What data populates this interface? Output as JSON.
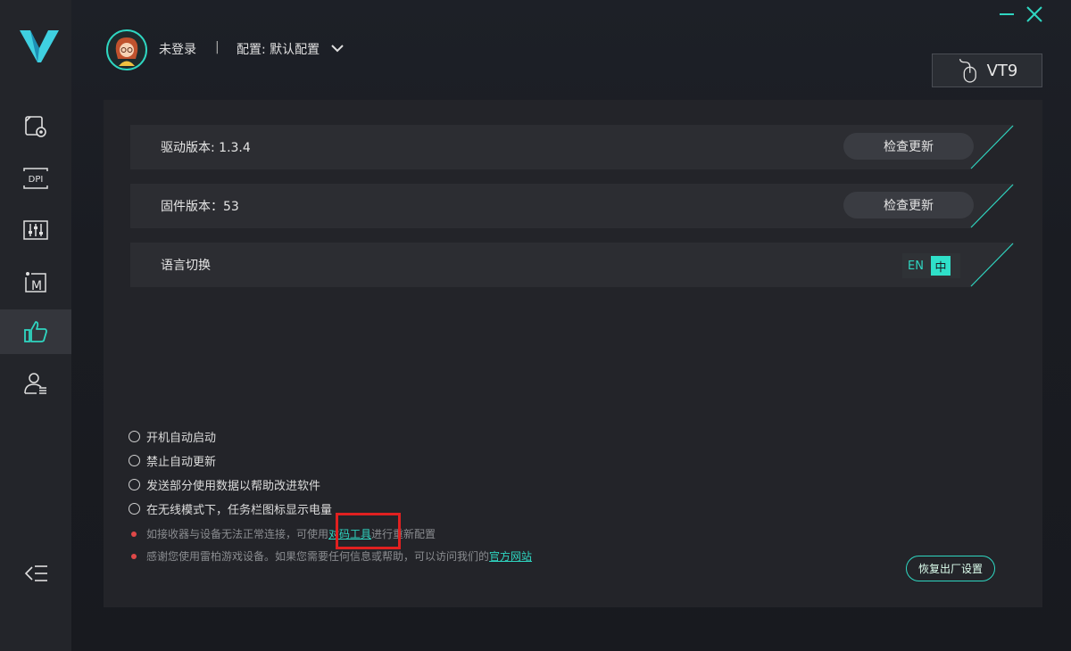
{
  "sidebar": {
    "logo_icon": "v-logo-icon",
    "items": [
      {
        "icon": "mouse-settings-icon",
        "active": false
      },
      {
        "icon": "dpi-icon",
        "active": false
      },
      {
        "icon": "equalizer-icon",
        "active": false
      },
      {
        "icon": "macro-icon",
        "active": false
      },
      {
        "icon": "thumbs-up-icon",
        "active": true
      },
      {
        "icon": "user-list-icon",
        "active": false
      }
    ],
    "collapse_icon": "collapse-menu-icon"
  },
  "header": {
    "login_status": "未登录",
    "separator": "|",
    "config_label": "配置: 默认配置",
    "device_name": "VT9"
  },
  "settings": {
    "driver": {
      "label": "驱动版本: 1.3.4",
      "button": "检查更新"
    },
    "firmware": {
      "label": "固件版本：53",
      "button": "检查更新"
    },
    "language": {
      "label": "语言切换",
      "en": "EN",
      "zh": "中"
    }
  },
  "options": [
    "开机自动启动",
    "禁止自动更新",
    "发送部分使用数据以帮助改进软件",
    "在无线模式下，任务栏图标显示电量"
  ],
  "notes": {
    "pairing": {
      "before": "如接收器与设备无法正常连接，可使用 ",
      "link": "对码工具",
      "after": " 进行重新配置"
    },
    "thanks": {
      "before": "感谢您使用雷柏游戏设备。如果您需要任何信息或帮助，可以访问我们的 ",
      "link": "官方网站"
    }
  },
  "reset_button": "恢复出厂设置",
  "colors": {
    "accent": "#2fd6c1",
    "highlight": "#e02020",
    "bullet": "#e04848"
  }
}
